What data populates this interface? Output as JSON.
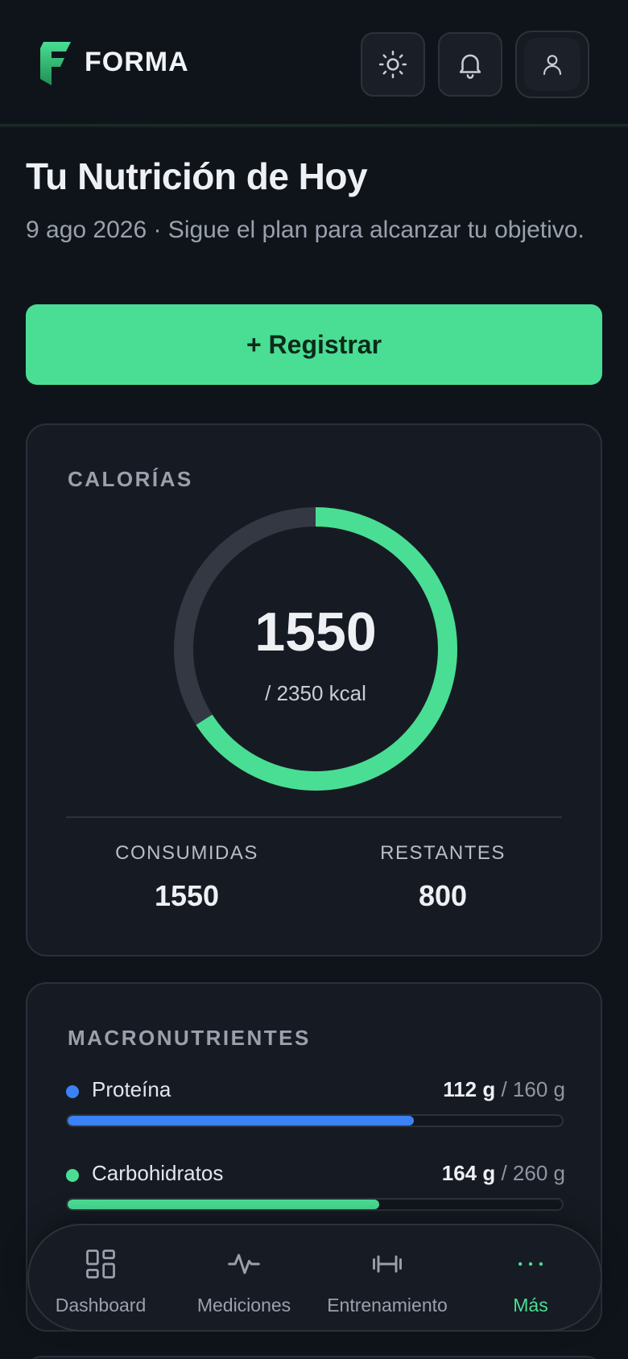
{
  "app": {
    "name": "FORMA"
  },
  "header": {
    "icons": [
      "sun-icon",
      "bell-icon",
      "user-icon"
    ]
  },
  "page": {
    "title": "Tu Nutrición de Hoy",
    "subtitle": "9 ago 2026 · Sigue el plan para alcanzar tu objetivo.",
    "cta_label": "+ Registrar"
  },
  "calories": {
    "label": "CALORÍAS",
    "consumed_display": "1550",
    "goal_display": "/ 2350 kcal",
    "consumed": 1550,
    "goal": 2350,
    "stats": [
      {
        "label": "CONSUMIDAS",
        "value": "1550"
      },
      {
        "label": "RESTANTES",
        "value": "800"
      }
    ]
  },
  "macros": {
    "label": "MACRONUTRIENTES",
    "items": [
      {
        "name": "Proteína",
        "current": "112 g",
        "target": "/ 160 g",
        "fraction": 0.7,
        "color": "#3b82f6"
      },
      {
        "name": "Carbohidratos",
        "current": "164 g",
        "target": "/ 260 g",
        "fraction": 0.63,
        "color": "#4ade94"
      }
    ]
  },
  "nav": {
    "items": [
      {
        "label": "Dashboard",
        "icon": "dashboard-icon",
        "active": false
      },
      {
        "label": "Mediciones",
        "icon": "activity-icon",
        "active": false
      },
      {
        "label": "Entrenamiento",
        "icon": "dumbbell-icon",
        "active": false
      },
      {
        "label": "Más",
        "icon": "more-icon",
        "active": true
      }
    ]
  },
  "colors": {
    "accent": "#4ade94",
    "protein": "#3b82f6",
    "background": "#0f141b",
    "card": "#161b23"
  }
}
